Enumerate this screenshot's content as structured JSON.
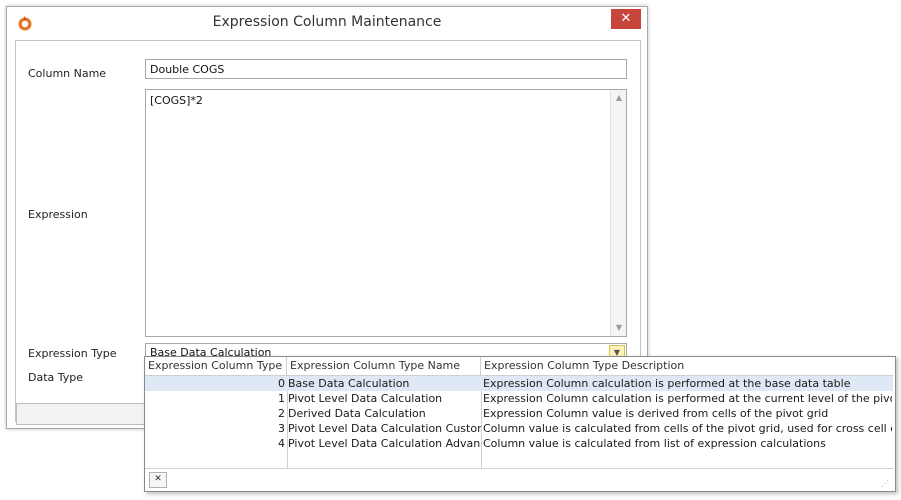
{
  "window": {
    "title": "Expression Column Maintenance",
    "close_label": "✕"
  },
  "form": {
    "column_name_label": "Column Name",
    "column_name_value": "Double COGS",
    "expression_label": "Expression",
    "expression_value": "[COGS]*2",
    "expression_type_label": "Expression Type",
    "expression_type_value": "Base Data Calculation",
    "data_type_label": "Data Type"
  },
  "dropdown": {
    "columns": [
      "Expression Column Type ID",
      "Expression Column Type Name",
      "Expression Column Type Description"
    ],
    "selected_index": 0,
    "rows": [
      {
        "id": "0",
        "name": "Base Data Calculation",
        "description": "Expression Column calculation is performed at the base data table"
      },
      {
        "id": "1",
        "name": "Pivot Level Data Calculation",
        "description": "Expression Column calculation is performed at the current level of the pivot grid"
      },
      {
        "id": "2",
        "name": "Derived Data Calculation",
        "description": "Expression Column value is derived from cells of the pivot grid"
      },
      {
        "id": "3",
        "name": "Pivot Level Data Calculation Custom",
        "description": "Column value is calculated from cells of the pivot grid, used for cross cell calculations"
      },
      {
        "id": "4",
        "name": "Pivot Level Data Calculation Advanced",
        "description": "Column value is calculated from list of expression calculations"
      }
    ]
  },
  "colors": {
    "close_button": "#c7453a",
    "selected_row": "#dfe9f5",
    "combo_button": "#fdf3b5",
    "app_icon": "#e8772e"
  },
  "icons": {
    "app": "app-logo-icon",
    "close": "close-icon",
    "combo": "chevron-down-icon",
    "scroll_up": "scroll-up-icon",
    "scroll_down": "scroll-down-icon",
    "clear": "clear-icon",
    "resize": "resize-grip-icon"
  }
}
